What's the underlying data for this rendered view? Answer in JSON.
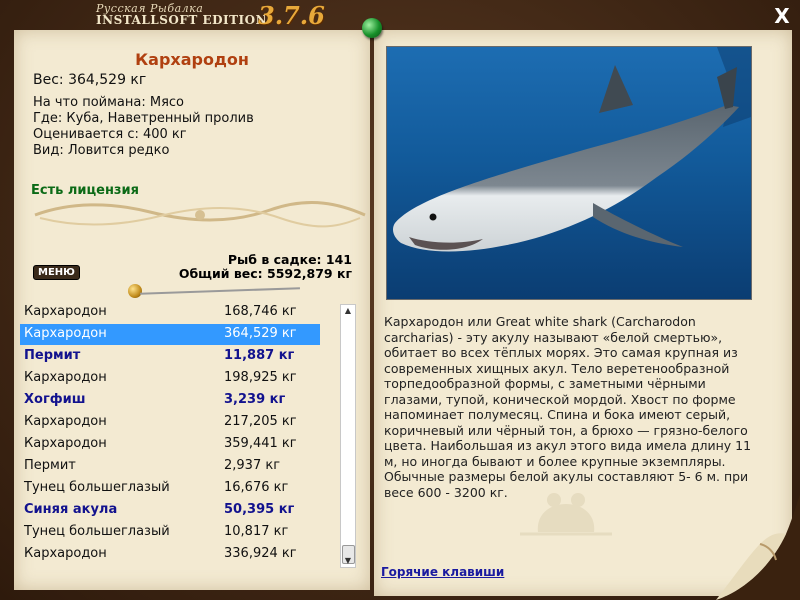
{
  "window": {
    "brand_line1": "Русская Рыбалка",
    "brand_line2": "INSTALLSOFT EDITION",
    "version": "3.7.6",
    "close_label": "X"
  },
  "fish": {
    "name": "Кархародон",
    "weight": "Вес: 364,529 кг",
    "bait": "На что поймана: Мясо",
    "location": "Где: Куба, Наветренный пролив",
    "valued_from": "Оценивается с: 400 кг",
    "rarity": "Вид: Ловится редко",
    "license": "Есть лицензия"
  },
  "stats": {
    "fish_count": "Рыб в садке: 141",
    "total_weight": "Общий вес: 5592,879 кг"
  },
  "menu_label": "МЕНЮ",
  "catch_list": [
    {
      "name": "Кархародон",
      "weight": "168,746 кг",
      "selected": false,
      "bold": false
    },
    {
      "name": "Кархародон",
      "weight": "364,529 кг",
      "selected": true,
      "bold": false
    },
    {
      "name": "Пермит",
      "weight": "11,887 кг",
      "selected": false,
      "bold": true
    },
    {
      "name": "Кархародон",
      "weight": "198,925 кг",
      "selected": false,
      "bold": false
    },
    {
      "name": "Хогфиш",
      "weight": "3,239 кг",
      "selected": false,
      "bold": true
    },
    {
      "name": "Кархародон",
      "weight": "217,205 кг",
      "selected": false,
      "bold": false
    },
    {
      "name": "Кархародон",
      "weight": "359,441 кг",
      "selected": false,
      "bold": false
    },
    {
      "name": "Пермит",
      "weight": "2,937 кг",
      "selected": false,
      "bold": false
    },
    {
      "name": "Тунец большеглазый",
      "weight": "16,676 кг",
      "selected": false,
      "bold": false
    },
    {
      "name": "Синяя акула",
      "weight": "50,395 кг",
      "selected": false,
      "bold": true
    },
    {
      "name": "Тунец большеглазый",
      "weight": "10,817 кг",
      "selected": false,
      "bold": false
    },
    {
      "name": "Кархародон",
      "weight": "336,924 кг",
      "selected": false,
      "bold": false
    }
  ],
  "description": "Кархародон или Great white shark (Carcharodon carcharias) - эту акулу называют «белой смертью», обитает во всех тёплых морях. Это самая крупная из современных хищных акул. Тело веретенообразной торпедообразной формы, с заметными чёрными глазами, тупой, конической мордой. Хвост по форме напоминает полумесяц. Спина и бока имеют серый, коричневый или чёрный тон, а брюхо — грязно-белого цвета. Наибольшая из акул этого вида имела длину 11 м, но иногда бывают и более крупные экземпляры. Обычные размеры белой акулы составляют 5- 6 м. при весе 600 - 3200 кг.",
  "hotkeys_label": "Горячие клавиши",
  "colors": {
    "paper": "#f3ead2",
    "fish_title": "#b04010",
    "license_green": "#0b6a16",
    "selection_blue": "#3399ff",
    "bold_fish": "#12128e",
    "link": "#1a1aa0"
  }
}
